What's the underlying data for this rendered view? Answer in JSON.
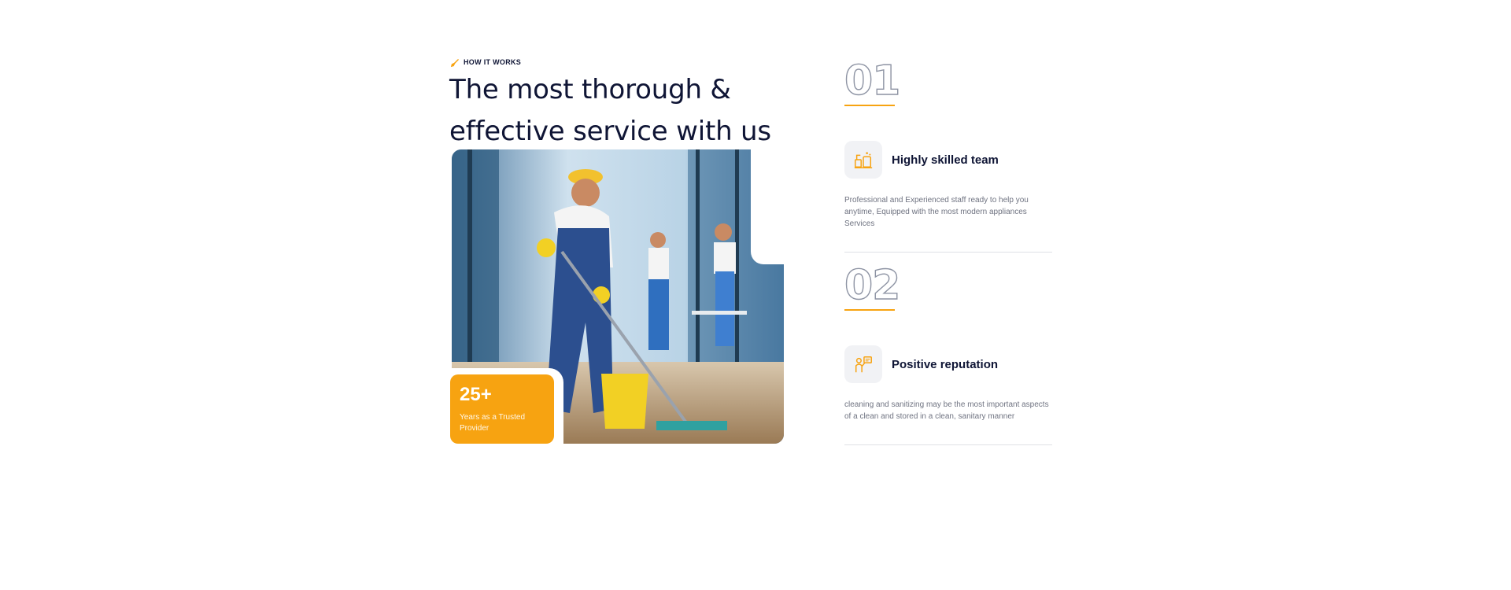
{
  "section": {
    "tagline": "How It Works",
    "heading_line1": "The most thorough &",
    "heading_line2": "effective service with us"
  },
  "badge": {
    "number": "25+",
    "label": "Years as a Trusted Provider"
  },
  "steps": [
    {
      "number": "01",
      "icon": "cleaning-supplies-icon",
      "title": "Highly skilled team",
      "description": "Professional and Experienced staff ready to help you anytime, Equipped with the most modern appliances Services"
    },
    {
      "number": "02",
      "icon": "cleaner-with-sign-icon",
      "title": "Positive reputation",
      "description": "cleaning and sanitizing may be the most important aspects of a clean and stored in a clean, sanitary manner"
    }
  ],
  "colors": {
    "accent": "#f7a311",
    "heading": "#0f1535",
    "muted": "#6f7381"
  }
}
